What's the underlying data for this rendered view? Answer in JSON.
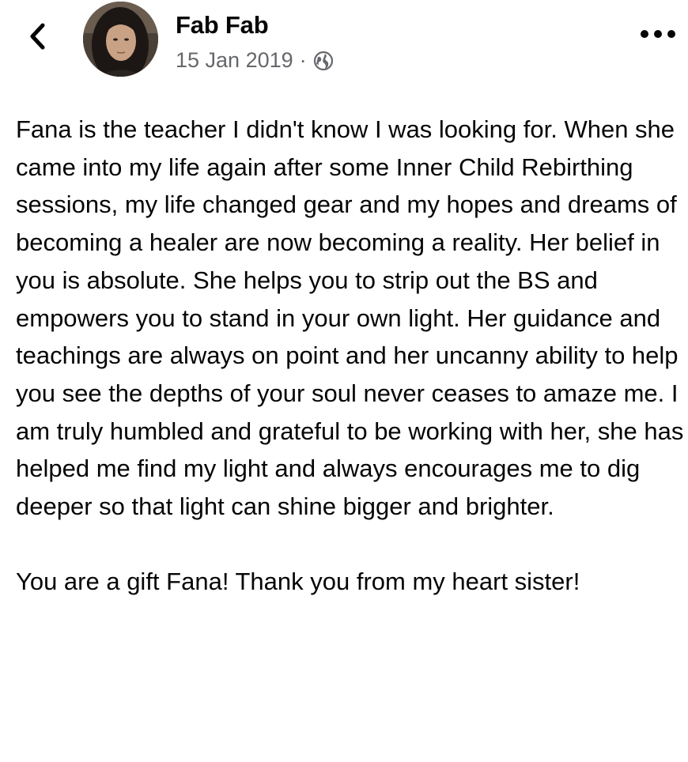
{
  "header": {
    "back_icon": "chevron-left-icon",
    "author_name": "Fab Fab",
    "date": "15 Jan 2019",
    "separator": "·",
    "audience_icon": "globe-icon",
    "more_icon": "more-horizontal-icon"
  },
  "post": {
    "paragraphs": [
      "Fana is the teacher I didn't know I was looking for. When she came into my life again after some Inner Child Rebirthing sessions, my life changed gear and my hopes and dreams of becoming a healer are now becoming a reality. Her belief in you is absolute. She helps you to strip out the BS and empowers you to stand in your own light. Her guidance and teachings are always on point and her uncanny ability to help you see the depths of your soul never ceases to amaze me. I am truly humbled and grateful to be working with her, she has helped me find my light and always encourages me to dig deeper so that light can shine bigger and brighter.",
      "You are a gift Fana! Thank you from my heart sister!"
    ]
  }
}
